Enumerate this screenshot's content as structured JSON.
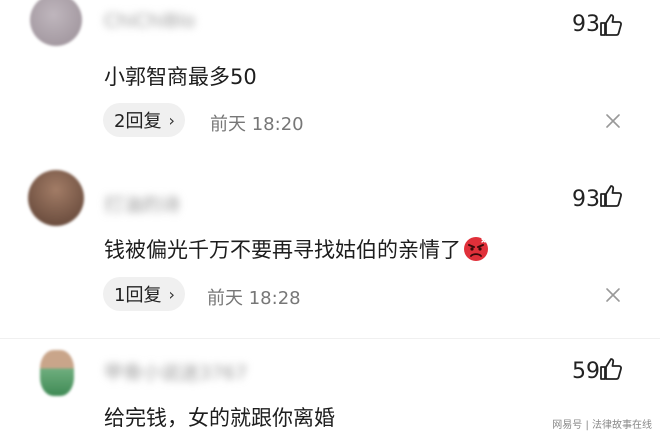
{
  "comments": [
    {
      "username": "ChiChiBlo",
      "likes": "93",
      "text": "小郭智商最多50",
      "reply_label": "2回复",
      "time": "前天 18:20",
      "avatar_color": "#c9c2c7",
      "has_emoji": false
    },
    {
      "username": "打油的诗",
      "likes": "93",
      "text": "钱被偏光千万不要再寻找姑伯的亲情了",
      "reply_label": "1回复",
      "time": "前天 18:28",
      "avatar_color": "#7a5a4a",
      "has_emoji": true,
      "emoji": "angry-face"
    },
    {
      "username": "甲骨小说迷3767",
      "likes": "59",
      "text": "给完钱，女的就跟你离婚",
      "avatar_color": "#7fb38a",
      "has_emoji": false
    }
  ],
  "watermark": "网易号 | 法律故事在线",
  "icons": {
    "like": "thumbs-up-icon",
    "close": "close-icon",
    "chevron": "chevron-right-icon"
  }
}
